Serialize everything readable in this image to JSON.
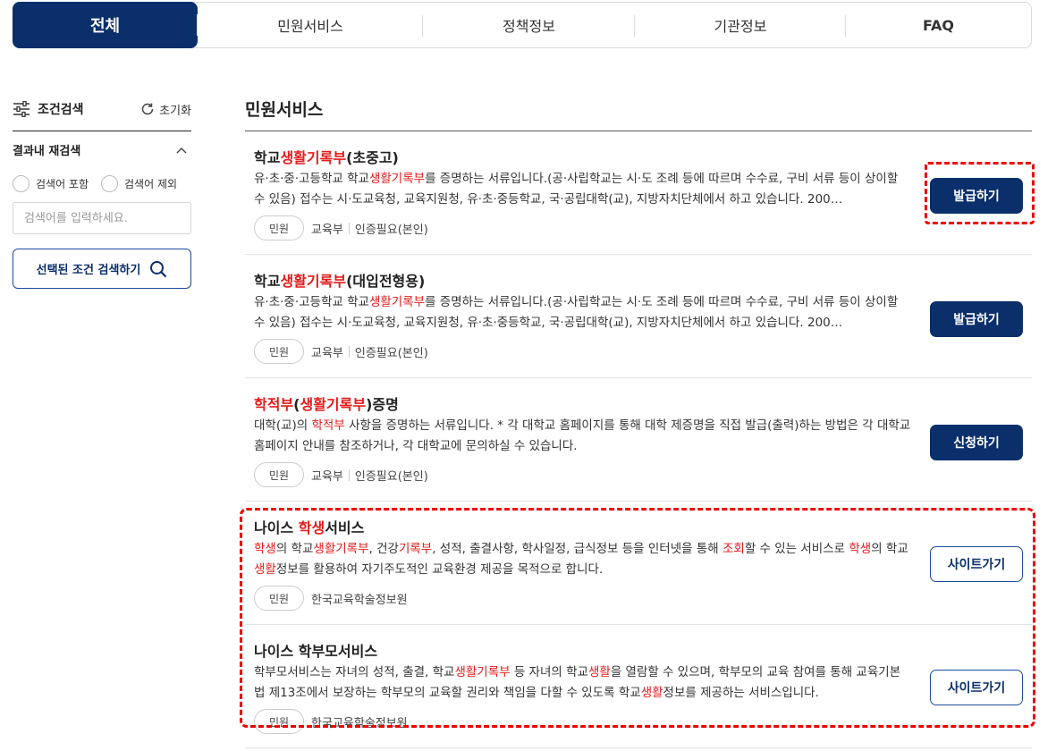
{
  "tabs": [
    {
      "label": "전체",
      "active": true
    },
    {
      "label": "민원서비스"
    },
    {
      "label": "정책정보"
    },
    {
      "label": "기관정보"
    },
    {
      "label": "FAQ"
    }
  ],
  "sidebar": {
    "title": "조건검색",
    "reset_label": "초기화",
    "result_search_label": "결과내 재검색",
    "radio_include": "검색어 포함",
    "radio_exclude": "검색어 제외",
    "input_placeholder": "검색어를 입력하세요.",
    "search_button": "선택된 조건 검색하기"
  },
  "main": {
    "section_title": "민원서비스",
    "cards": [
      {
        "title_parts": [
          [
            "학교",
            ""
          ],
          [
            "생활기록부",
            "hl"
          ],
          [
            "(초중고)",
            ""
          ]
        ],
        "desc_parts": [
          [
            "유·초·중·고등학교 학교",
            ""
          ],
          [
            "생활기록부",
            "hl"
          ],
          [
            "를 증명하는 서류입니다.(공·사립학교는 시·도 조례 등에 따르며 수수료, 구비 서류 등이 상이할 수 있음) 접수는 시·도교육청, 교육지원청, 유·초·중등학교, 국·공립대학(교), 지방자치단체에서 하고 있습니다. 200…",
            ""
          ]
        ],
        "tag": "민원",
        "org": "교육부",
        "auth": "인증필요(본인)",
        "button": "발급하기",
        "button_style": "solid"
      },
      {
        "title_parts": [
          [
            "학교",
            ""
          ],
          [
            "생활기록부",
            "hl"
          ],
          [
            "(대입전형용)",
            ""
          ]
        ],
        "desc_parts": [
          [
            "유·초·중·고등학교 학교",
            ""
          ],
          [
            "생활기록부",
            "hl"
          ],
          [
            "를 증명하는 서류입니다.(공·사립학교는 시·도 조례 등에 따르며 수수료, 구비 서류 등이 상이할 수 있음) 접수는 시·도교육청, 교육지원청, 유·초·중등학교, 국·공립대학(교), 지방자치단체에서 하고 있습니다. 200…",
            ""
          ]
        ],
        "tag": "민원",
        "org": "교육부",
        "auth": "인증필요(본인)",
        "button": "발급하기",
        "button_style": "solid"
      },
      {
        "title_parts": [
          [
            "학적부",
            "hl"
          ],
          [
            "(",
            ""
          ],
          [
            "생활기록부",
            "hl"
          ],
          [
            ")증명",
            ""
          ]
        ],
        "desc_parts": [
          [
            "대학(교)의 ",
            ""
          ],
          [
            "학적부",
            "hl"
          ],
          [
            " 사항을 증명하는 서류입니다. * 각 대학교 홈페이지를 통해 대학 제증명을 직접 발급(출력)하는 방법은 각 대학교 홈페이지 안내를 참조하거나, 각 대학교에 문의하실 수 있습니다.",
            ""
          ]
        ],
        "tag": "민원",
        "org": "교육부",
        "auth": "인증필요(본인)",
        "button": "신청하기",
        "button_style": "solid"
      },
      {
        "title_parts": [
          [
            "나이스 ",
            ""
          ],
          [
            "학생",
            "hl"
          ],
          [
            "서비스",
            ""
          ]
        ],
        "desc_parts": [
          [
            "학생",
            "hl"
          ],
          [
            "의 학교",
            ""
          ],
          [
            "생활기록부",
            "hl"
          ],
          [
            ", 건강",
            ""
          ],
          [
            "기록부",
            "hl"
          ],
          [
            ", 성적, 출결사항, 학사일정, 급식정보 등을 인터넷을 통해 ",
            ""
          ],
          [
            "조회",
            "hl"
          ],
          [
            "할 수 있는 서비스로 ",
            ""
          ],
          [
            "학생",
            "hl"
          ],
          [
            "의 학교",
            ""
          ],
          [
            "생활",
            "hl"
          ],
          [
            "정보를 활용하여 자기주도적인 교육환경 제공을 목적으로 합니다.",
            ""
          ]
        ],
        "tag": "민원",
        "org": "한국교육학술정보원",
        "auth": "",
        "button": "사이트가기",
        "button_style": "outline"
      },
      {
        "title_parts": [
          [
            "나이스 학부모서비스",
            ""
          ]
        ],
        "desc_parts": [
          [
            "학부모서비스는 자녀의 성적, 출결, 학교",
            ""
          ],
          [
            "생활기록부",
            "hl"
          ],
          [
            " 등 자녀의 학교",
            ""
          ],
          [
            "생활",
            "hl"
          ],
          [
            "을 열람할 수 있으며, 학부모의 교육 참여를 통해 교육기본법 제13조에서 보장하는 학부모의 교육할 권리와 책임을 다할 수 있도록 학교",
            ""
          ],
          [
            "생활",
            "hl"
          ],
          [
            "정보를 제공하는 서비스입니다.",
            ""
          ]
        ],
        "tag": "민원",
        "org": "한국교육학술정보원",
        "auth": "",
        "button": "사이트가기",
        "button_style": "outline"
      }
    ]
  },
  "colors": {
    "primary": "#0b2f6b",
    "highlight": "#e31b1b",
    "annotation": "#ee0000"
  }
}
